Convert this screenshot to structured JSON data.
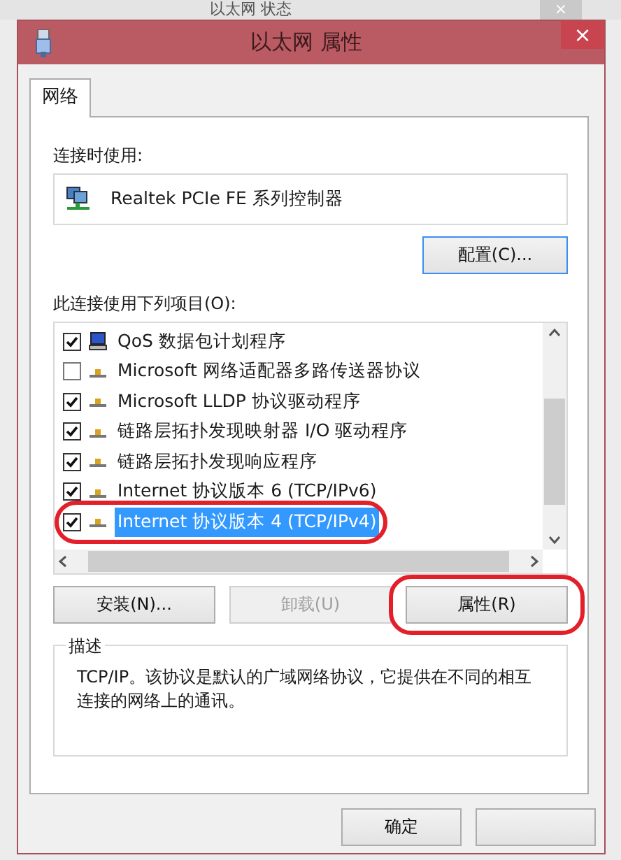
{
  "back_window": {
    "title": "以太网 状态",
    "close": "×"
  },
  "window": {
    "title": "以太网 属性",
    "close": "×"
  },
  "tabs": [
    {
      "label": "网络",
      "selected": true
    }
  ],
  "connect_using": {
    "label": "连接时使用:",
    "adapter": "Realtek PCIe FE 系列控制器",
    "configure_button": "配置(C)..."
  },
  "items_label": "此连接使用下列项目(O):",
  "items": [
    {
      "kind": "service",
      "name": "QoS 数据包计划程序",
      "checked": true,
      "selected": false,
      "circled": false
    },
    {
      "kind": "protocol",
      "name": "Microsoft 网络适配器多路传送器协议",
      "checked": false,
      "selected": false,
      "circled": false
    },
    {
      "kind": "protocol",
      "name": "Microsoft LLDP 协议驱动程序",
      "checked": true,
      "selected": false,
      "circled": false
    },
    {
      "kind": "protocol",
      "name": "链路层拓扑发现映射器 I/O 驱动程序",
      "checked": true,
      "selected": false,
      "circled": false
    },
    {
      "kind": "protocol",
      "name": "链路层拓扑发现响应程序",
      "checked": true,
      "selected": false,
      "circled": false
    },
    {
      "kind": "protocol",
      "name": "Internet 协议版本 6 (TCP/IPv6)",
      "checked": true,
      "selected": false,
      "circled": false
    },
    {
      "kind": "protocol",
      "name": "Internet 协议版本 4 (TCP/IPv4)",
      "checked": true,
      "selected": true,
      "circled": true
    }
  ],
  "item_buttons": [
    {
      "label": "安装(N)...",
      "disabled": false,
      "circled": false
    },
    {
      "label": "卸载(U)",
      "disabled": true,
      "circled": false
    },
    {
      "label": "属性(R)",
      "disabled": false,
      "circled": true
    }
  ],
  "description": {
    "title": "描述",
    "text": "TCP/IP。该协议是默认的广域网络协议，它提供在不同的相互连接的网络上的通讯。"
  },
  "footer_buttons": [
    {
      "label": "确定"
    }
  ]
}
